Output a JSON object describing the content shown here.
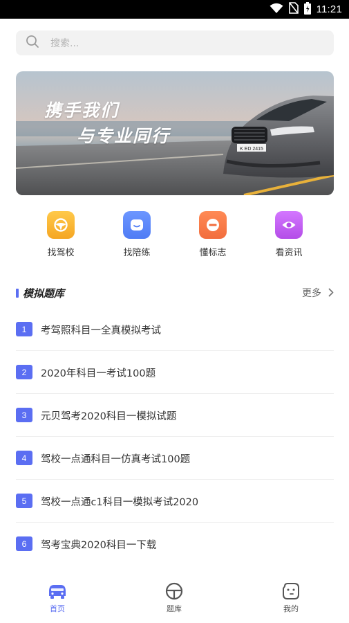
{
  "status": {
    "time": "11:21"
  },
  "search": {
    "placeholder": "搜索..."
  },
  "banner": {
    "line1": "携手我们",
    "line2": "与专业同行",
    "plate": "K ED 2415"
  },
  "quick": [
    {
      "label": "找驾校",
      "icon": "steering-wheel-icon",
      "color": "#f5a623"
    },
    {
      "label": "找陪练",
      "icon": "smile-face-icon",
      "color": "#4f7cf5"
    },
    {
      "label": "懂标志",
      "icon": "no-entry-sign-icon",
      "color": "#f26d3d"
    },
    {
      "label": "看资讯",
      "icon": "eye-icon",
      "color": "#b44de8"
    }
  ],
  "section": {
    "title": "模拟题库",
    "more": "更多"
  },
  "items": [
    {
      "num": "1",
      "text": "考驾照科目一全真模拟考试"
    },
    {
      "num": "2",
      "text": " 2020年科目一考试100题"
    },
    {
      "num": "3",
      "text": "元贝驾考2020科目一模拟试题"
    },
    {
      "num": "4",
      "text": "驾校一点通科目一仿真考试100题"
    },
    {
      "num": "5",
      "text": "驾校一点通c1科目一模拟考试2020"
    },
    {
      "num": "6",
      "text": "驾考宝典2020科目一下载"
    }
  ],
  "tabs": [
    {
      "label": "首页",
      "icon": "car-icon",
      "active": true
    },
    {
      "label": "题库",
      "icon": "steering-wheel-icon",
      "active": false
    },
    {
      "label": "我的",
      "icon": "profile-face-icon",
      "active": false
    }
  ],
  "colors": {
    "accent": "#5b6ef2",
    "statusbar": "#000000",
    "search_bg": "#f2f2f2"
  }
}
